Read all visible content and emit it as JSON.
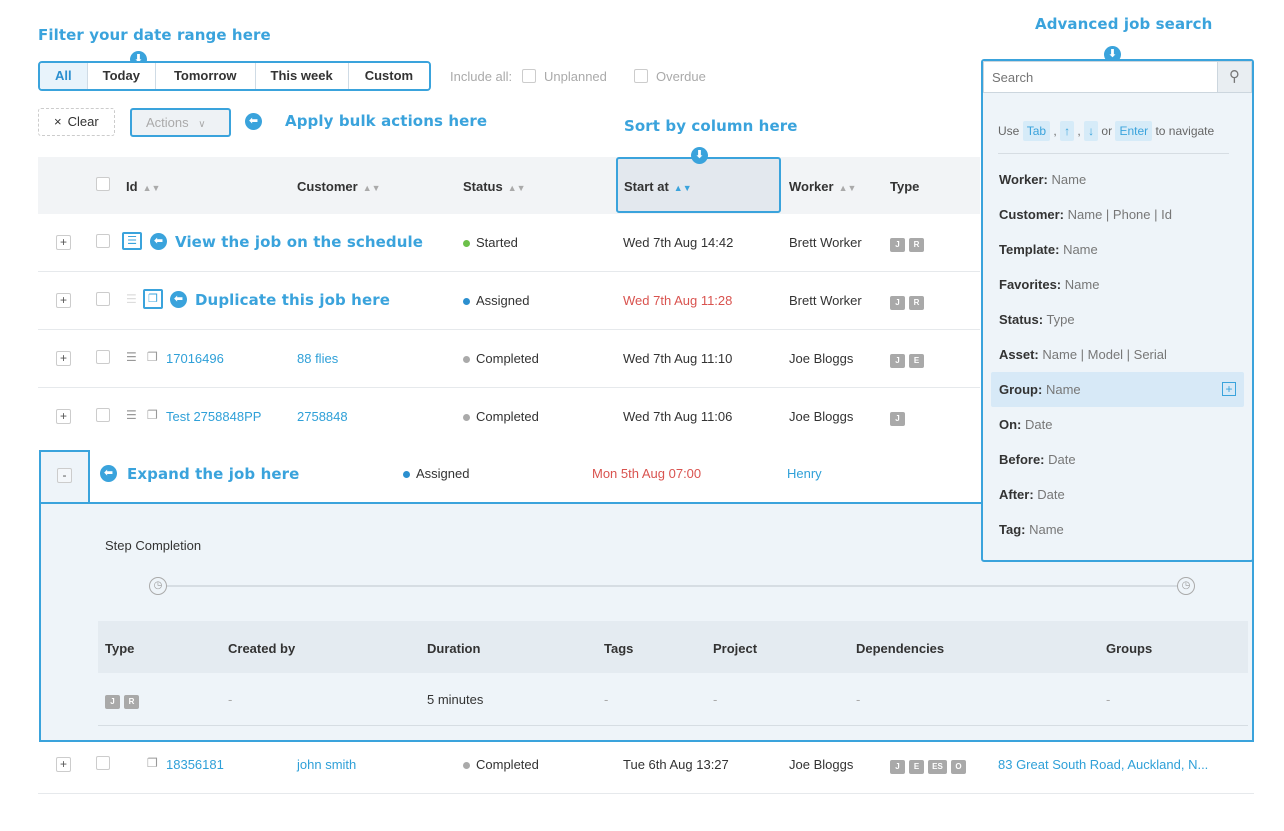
{
  "annotations": {
    "filter": "Filter your date range here",
    "advanced": "Advanced job search",
    "bulk": "Apply bulk actions here",
    "sort": "Sort by column here",
    "view_schedule": "View the job on the schedule",
    "duplicate": "Duplicate this job here",
    "expand": "Expand the job here"
  },
  "filter_tabs": [
    "All",
    "Today",
    "Tomorrow",
    "This week",
    "Custom"
  ],
  "include_all": {
    "label": "Include all:",
    "options": [
      "Unplanned",
      "Overdue"
    ]
  },
  "toolbar": {
    "clear_label": "Clear",
    "actions_label": "Actions"
  },
  "columns": [
    "Id",
    "Customer",
    "Status",
    "Start at",
    "Worker",
    "Type"
  ],
  "rows": [
    {
      "id": "",
      "customer": "",
      "status": "Started",
      "status_color": "#6cc04a",
      "start": "Wed 7th Aug 14:42",
      "start_overdue": false,
      "worker": "Brett Worker",
      "tags": [
        "J",
        "R"
      ]
    },
    {
      "id": "",
      "customer": "",
      "status": "Assigned",
      "status_color": "#2b8fcf",
      "start": "Wed 7th Aug 11:28",
      "start_overdue": true,
      "worker": "Brett Worker",
      "tags": [
        "J",
        "R"
      ]
    },
    {
      "id": "17016496",
      "customer": "88 flies",
      "status": "Completed",
      "status_color": "#aaaaaa",
      "start": "Wed 7th Aug 11:10",
      "start_overdue": false,
      "worker": "Joe Bloggs",
      "tags": [
        "J",
        "E"
      ]
    },
    {
      "id": "Test 2758848PP",
      "customer": "2758848",
      "status": "Completed",
      "status_color": "#aaaaaa",
      "start": "Wed 7th Aug 11:06",
      "start_overdue": false,
      "worker": "Joe Bloggs",
      "tags": [
        "J"
      ]
    }
  ],
  "expanded_row": {
    "toggle": "-",
    "status": "Assigned",
    "start": "Mon 5th Aug 07:00",
    "worker": "Henry",
    "step_completion": "Step Completion",
    "sub_columns": [
      "Type",
      "Created by",
      "Duration",
      "Tags",
      "Project",
      "Dependencies",
      "Groups"
    ],
    "sub_values": {
      "created_by": "-",
      "duration": "5 minutes",
      "tags": "-",
      "project": "-",
      "dependencies": "-",
      "groups": "-"
    },
    "sub_type_tags": [
      "J",
      "R"
    ]
  },
  "last_row": {
    "id": "18356181",
    "customer": "john smith",
    "status": "Completed",
    "start": "Tue 6th Aug 13:27",
    "worker": "Joe Bloggs",
    "tags": [
      "J",
      "E",
      "ES",
      "O"
    ],
    "address": "83 Great South Road, Auckland, N..."
  },
  "search": {
    "placeholder": "Search",
    "hint": {
      "use": "Use",
      "tab": "Tab",
      "up": "↑",
      "down": "↓",
      "or": "or",
      "enter": "Enter",
      "navigate": "to navigate"
    },
    "options": [
      {
        "key": "Worker:",
        "val": "Name"
      },
      {
        "key": "Customer:",
        "val": "Name | Phone | Id"
      },
      {
        "key": "Template:",
        "val": "Name"
      },
      {
        "key": "Favorites:",
        "val": "Name"
      },
      {
        "key": "Status:",
        "val": "Type"
      },
      {
        "key": "Asset:",
        "val": "Name | Model | Serial"
      },
      {
        "key": "Group:",
        "val": "Name"
      },
      {
        "key": "On:",
        "val": "Date"
      },
      {
        "key": "Before:",
        "val": "Date"
      },
      {
        "key": "After:",
        "val": "Date"
      },
      {
        "key": "Tag:",
        "val": "Name"
      }
    ]
  },
  "colors": {
    "accent": "#3aa3dc",
    "link": "#2fa0d8",
    "overdue": "#d9534f"
  }
}
